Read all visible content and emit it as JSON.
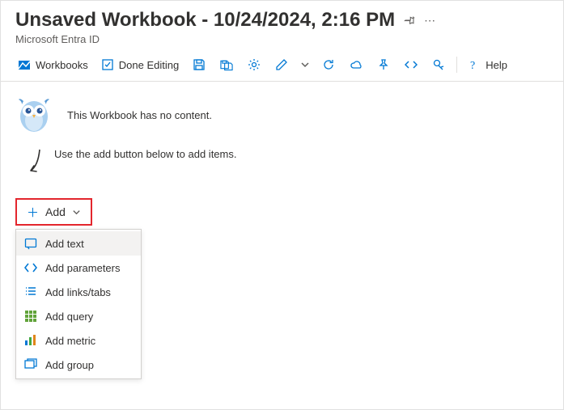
{
  "header": {
    "title": "Unsaved Workbook - 10/24/2024, 2:16 PM",
    "subtitle": "Microsoft Entra ID"
  },
  "toolbar": {
    "workbooks": "Workbooks",
    "done_editing": "Done Editing",
    "help": "Help"
  },
  "content": {
    "empty_message": "This Workbook has no content.",
    "hint": "Use the add button below to add items."
  },
  "add_button": {
    "label": "Add"
  },
  "add_menu": [
    {
      "label": "Add text"
    },
    {
      "label": "Add parameters"
    },
    {
      "label": "Add links/tabs"
    },
    {
      "label": "Add query"
    },
    {
      "label": "Add metric"
    },
    {
      "label": "Add group"
    }
  ]
}
